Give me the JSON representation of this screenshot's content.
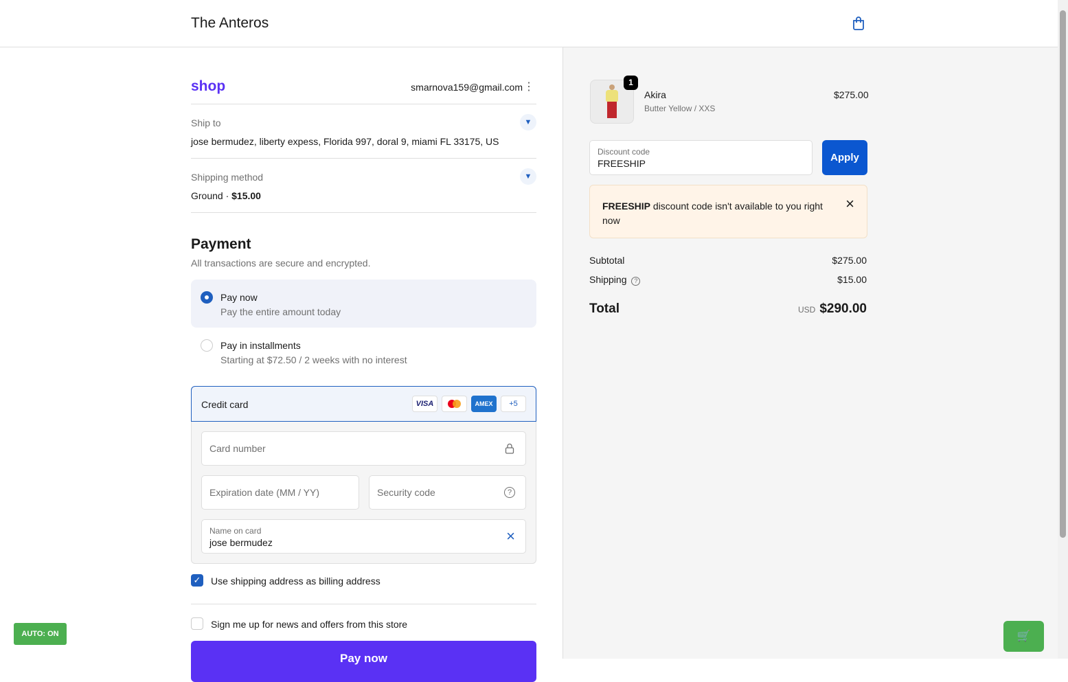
{
  "header": {
    "store_name": "The Anteros"
  },
  "account": {
    "shop_logo": "shop",
    "email": "smarnova159@gmail.com"
  },
  "ship_to": {
    "label": "Ship to",
    "value": "jose bermudez, liberty expess, Florida 997, doral 9, miami FL 33175, US"
  },
  "shipping_method": {
    "label": "Shipping method",
    "method": "Ground · ",
    "price": "$15.00"
  },
  "payment": {
    "title": "Payment",
    "subtitle": "All transactions are secure and encrypted.",
    "options": [
      {
        "title": "Pay now",
        "desc": "Pay the entire amount today",
        "selected": true
      },
      {
        "title": "Pay in installments",
        "desc": "Starting at $72.50 / 2 weeks with no interest",
        "selected": false
      }
    ],
    "credit_card_label": "Credit card",
    "card_brands": [
      "VISA",
      "Mastercard",
      "AMEX",
      "+5"
    ],
    "card_number_placeholder": "Card number",
    "expiry_placeholder": "Expiration date (MM / YY)",
    "security_placeholder": "Security code",
    "name_label": "Name on card",
    "name_value": "jose bermudez",
    "billing_checkbox": "Use shipping address as billing address",
    "billing_checked": true,
    "newsletter_checkbox": "Sign me up for news and offers from this store",
    "newsletter_checked": false,
    "pay_button": "Pay now"
  },
  "cart": {
    "item": {
      "name": "Akira",
      "variant": "Butter Yellow / XXS",
      "price": "$275.00",
      "quantity": "1"
    },
    "discount_label": "Discount code",
    "discount_value": "FREESHIP",
    "apply": "Apply",
    "error_code": "FREESHIP",
    "error_text": " discount code isn't available to you right now",
    "subtotal_label": "Subtotal",
    "subtotal": "$275.00",
    "shipping_label": "Shipping",
    "shipping": "$15.00",
    "total_label": "Total",
    "currency": "USD",
    "total": "$290.00"
  },
  "auto_badge": "AUTO: ON",
  "colors": {
    "accent": "#1f5fbf",
    "pay_button": "#5a31f4",
    "shop_logo": "#5a31f4",
    "auto_badge": "#4caf50"
  }
}
